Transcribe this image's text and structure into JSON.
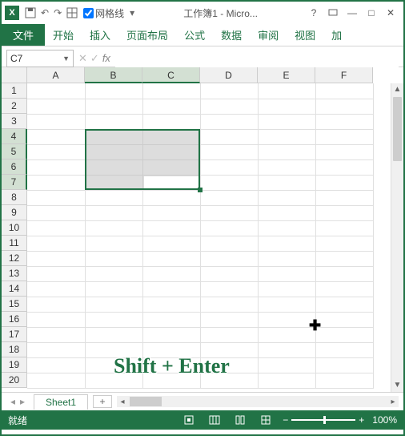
{
  "titlebar": {
    "gridlines_label": "网格线",
    "doc_title": "工作簿1 - Micro..."
  },
  "ribbon": {
    "file": "文件",
    "home": "开始",
    "insert": "插入",
    "page_layout": "页面布局",
    "formulas": "公式",
    "data": "数据",
    "review": "审阅",
    "view": "视图",
    "addins": "加"
  },
  "formula": {
    "name_box": "C7",
    "fx_label": "fx"
  },
  "columns": [
    "A",
    "B",
    "C",
    "D",
    "E",
    "F"
  ],
  "rows": [
    "1",
    "2",
    "3",
    "4",
    "5",
    "6",
    "7",
    "8",
    "9",
    "10",
    "11",
    "12",
    "13",
    "14",
    "15",
    "16",
    "17",
    "18",
    "19",
    "20"
  ],
  "selected_cols": [
    "B",
    "C"
  ],
  "selected_rows": [
    "4",
    "5",
    "6",
    "7"
  ],
  "active_cell": "C7",
  "overlay_text": "Shift + Enter",
  "sheet_tabs": {
    "sheet1": "Sheet1",
    "add": "+"
  },
  "statusbar": {
    "ready": "就绪",
    "zoom": "100%",
    "minus": "−",
    "plus": "+"
  }
}
